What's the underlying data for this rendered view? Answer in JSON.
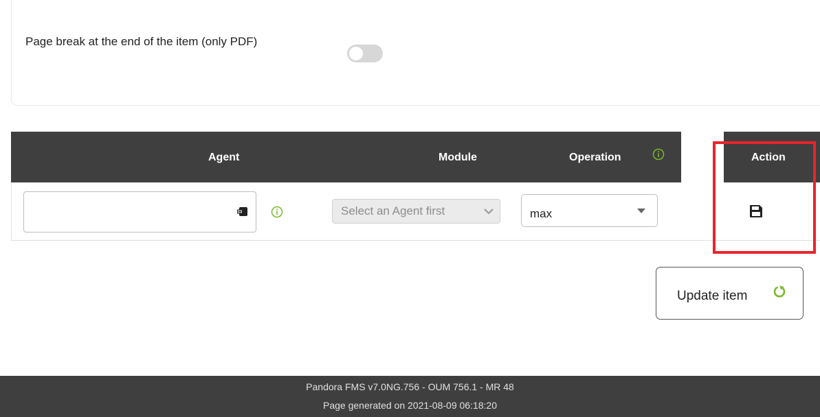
{
  "options": {
    "page_break_label": "Page break at the end of the item (only PDF)",
    "page_break_enabled": false
  },
  "table": {
    "columns": {
      "agent": "Agent",
      "module": "Module",
      "operation": "Operation",
      "action": "Action"
    },
    "row": {
      "agent_value": "",
      "module_placeholder": "Select an Agent first",
      "operation_value": "max"
    }
  },
  "buttons": {
    "update_label": "Update item"
  },
  "footer": {
    "version": "Pandora FMS v7.0NG.756 - OUM 756.1 - MR 48",
    "generated": "Page generated on 2021-08-09 06:18:20"
  },
  "colors": {
    "header_bg": "#3f3f3f",
    "info_green": "#7ab929",
    "highlight_red": "#e8242d",
    "toggle_off": "#d7d7d7"
  },
  "icons": {
    "agent_field": "agent-selector-icon",
    "info": "info-icon",
    "save": "floppy-disk-icon",
    "refresh": "refresh-icon"
  }
}
